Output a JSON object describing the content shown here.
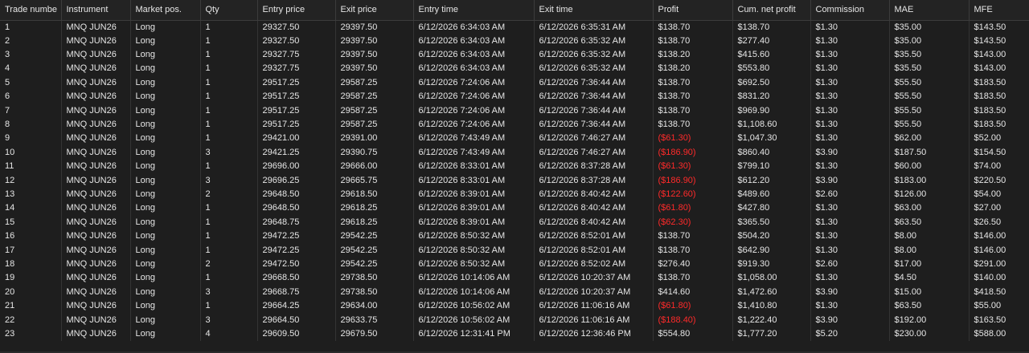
{
  "columns": [
    "Trade numbe",
    "Instrument",
    "Market pos.",
    "Qty",
    "Entry price",
    "Exit price",
    "Entry time",
    "Exit time",
    "Profit",
    "Cum. net profit",
    "Commission",
    "MAE",
    "MFE"
  ],
  "rows": [
    [
      "1",
      "MNQ JUN26",
      "Long",
      "1",
      "29327.50",
      "29397.50",
      "6/12/2026 6:34:03 AM",
      "6/12/2026 6:35:31 AM",
      "$138.70",
      "$138.70",
      "$1.30",
      "$35.00",
      "$143.50"
    ],
    [
      "2",
      "MNQ JUN26",
      "Long",
      "1",
      "29327.50",
      "29397.50",
      "6/12/2026 6:34:03 AM",
      "6/12/2026 6:35:32 AM",
      "$138.70",
      "$277.40",
      "$1.30",
      "$35.00",
      "$143.50"
    ],
    [
      "3",
      "MNQ JUN26",
      "Long",
      "1",
      "29327.75",
      "29397.50",
      "6/12/2026 6:34:03 AM",
      "6/12/2026 6:35:32 AM",
      "$138.20",
      "$415.60",
      "$1.30",
      "$35.50",
      "$143.00"
    ],
    [
      "4",
      "MNQ JUN26",
      "Long",
      "1",
      "29327.75",
      "29397.50",
      "6/12/2026 6:34:03 AM",
      "6/12/2026 6:35:32 AM",
      "$138.20",
      "$553.80",
      "$1.30",
      "$35.50",
      "$143.00"
    ],
    [
      "5",
      "MNQ JUN26",
      "Long",
      "1",
      "29517.25",
      "29587.25",
      "6/12/2026 7:24:06 AM",
      "6/12/2026 7:36:44 AM",
      "$138.70",
      "$692.50",
      "$1.30",
      "$55.50",
      "$183.50"
    ],
    [
      "6",
      "MNQ JUN26",
      "Long",
      "1",
      "29517.25",
      "29587.25",
      "6/12/2026 7:24:06 AM",
      "6/12/2026 7:36:44 AM",
      "$138.70",
      "$831.20",
      "$1.30",
      "$55.50",
      "$183.50"
    ],
    [
      "7",
      "MNQ JUN26",
      "Long",
      "1",
      "29517.25",
      "29587.25",
      "6/12/2026 7:24:06 AM",
      "6/12/2026 7:36:44 AM",
      "$138.70",
      "$969.90",
      "$1.30",
      "$55.50",
      "$183.50"
    ],
    [
      "8",
      "MNQ JUN26",
      "Long",
      "1",
      "29517.25",
      "29587.25",
      "6/12/2026 7:24:06 AM",
      "6/12/2026 7:36:44 AM",
      "$138.70",
      "$1,108.60",
      "$1.30",
      "$55.50",
      "$183.50"
    ],
    [
      "9",
      "MNQ JUN26",
      "Long",
      "1",
      "29421.00",
      "29391.00",
      "6/12/2026 7:43:49 AM",
      "6/12/2026 7:46:27 AM",
      "($61.30)",
      "$1,047.30",
      "$1.30",
      "$62.00",
      "$52.00"
    ],
    [
      "10",
      "MNQ JUN26",
      "Long",
      "3",
      "29421.25",
      "29390.75",
      "6/12/2026 7:43:49 AM",
      "6/12/2026 7:46:27 AM",
      "($186.90)",
      "$860.40",
      "$3.90",
      "$187.50",
      "$154.50"
    ],
    [
      "11",
      "MNQ JUN26",
      "Long",
      "1",
      "29696.00",
      "29666.00",
      "6/12/2026 8:33:01 AM",
      "6/12/2026 8:37:28 AM",
      "($61.30)",
      "$799.10",
      "$1.30",
      "$60.00",
      "$74.00"
    ],
    [
      "12",
      "MNQ JUN26",
      "Long",
      "3",
      "29696.25",
      "29665.75",
      "6/12/2026 8:33:01 AM",
      "6/12/2026 8:37:28 AM",
      "($186.90)",
      "$612.20",
      "$3.90",
      "$183.00",
      "$220.50"
    ],
    [
      "13",
      "MNQ JUN26",
      "Long",
      "2",
      "29648.50",
      "29618.50",
      "6/12/2026 8:39:01 AM",
      "6/12/2026 8:40:42 AM",
      "($122.60)",
      "$489.60",
      "$2.60",
      "$126.00",
      "$54.00"
    ],
    [
      "14",
      "MNQ JUN26",
      "Long",
      "1",
      "29648.50",
      "29618.25",
      "6/12/2026 8:39:01 AM",
      "6/12/2026 8:40:42 AM",
      "($61.80)",
      "$427.80",
      "$1.30",
      "$63.00",
      "$27.00"
    ],
    [
      "15",
      "MNQ JUN26",
      "Long",
      "1",
      "29648.75",
      "29618.25",
      "6/12/2026 8:39:01 AM",
      "6/12/2026 8:40:42 AM",
      "($62.30)",
      "$365.50",
      "$1.30",
      "$63.50",
      "$26.50"
    ],
    [
      "16",
      "MNQ JUN26",
      "Long",
      "1",
      "29472.25",
      "29542.25",
      "6/12/2026 8:50:32 AM",
      "6/12/2026 8:52:01 AM",
      "$138.70",
      "$504.20",
      "$1.30",
      "$8.00",
      "$146.00"
    ],
    [
      "17",
      "MNQ JUN26",
      "Long",
      "1",
      "29472.25",
      "29542.25",
      "6/12/2026 8:50:32 AM",
      "6/12/2026 8:52:01 AM",
      "$138.70",
      "$642.90",
      "$1.30",
      "$8.00",
      "$146.00"
    ],
    [
      "18",
      "MNQ JUN26",
      "Long",
      "2",
      "29472.50",
      "29542.25",
      "6/12/2026 8:50:32 AM",
      "6/12/2026 8:52:02 AM",
      "$276.40",
      "$919.30",
      "$2.60",
      "$17.00",
      "$291.00"
    ],
    [
      "19",
      "MNQ JUN26",
      "Long",
      "1",
      "29668.50",
      "29738.50",
      "6/12/2026 10:14:06 AM",
      "6/12/2026 10:20:37 AM",
      "$138.70",
      "$1,058.00",
      "$1.30",
      "$4.50",
      "$140.00"
    ],
    [
      "20",
      "MNQ JUN26",
      "Long",
      "3",
      "29668.75",
      "29738.50",
      "6/12/2026 10:14:06 AM",
      "6/12/2026 10:20:37 AM",
      "$414.60",
      "$1,472.60",
      "$3.90",
      "$15.00",
      "$418.50"
    ],
    [
      "21",
      "MNQ JUN26",
      "Long",
      "1",
      "29664.25",
      "29634.00",
      "6/12/2026 10:56:02 AM",
      "6/12/2026 11:06:16 AM",
      "($61.80)",
      "$1,410.80",
      "$1.30",
      "$63.50",
      "$55.00"
    ],
    [
      "22",
      "MNQ JUN26",
      "Long",
      "3",
      "29664.50",
      "29633.75",
      "6/12/2026 10:56:02 AM",
      "6/12/2026 11:06:16 AM",
      "($188.40)",
      "$1,222.40",
      "$3.90",
      "$192.00",
      "$163.50"
    ],
    [
      "23",
      "MNQ JUN26",
      "Long",
      "4",
      "29609.50",
      "29679.50",
      "6/12/2026 12:31:41 PM",
      "6/12/2026 12:36:46 PM",
      "$554.80",
      "$1,777.20",
      "$5.20",
      "$230.00",
      "$588.00"
    ]
  ],
  "colors": {
    "background": "#1e1e1e",
    "text": "#e6e6e6",
    "negative": "#ff2a2a",
    "grid": "#343434"
  }
}
